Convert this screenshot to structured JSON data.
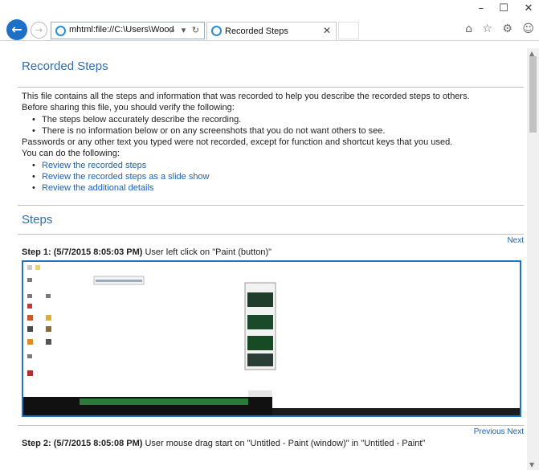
{
  "window": {
    "minimize": "–",
    "maximize": "☐",
    "close": "✕"
  },
  "browser": {
    "address": "mhtml:file://C:\\Users\\Wood",
    "address_icons": "⌕ ▾ ↻",
    "tab_title": "Recorded Steps",
    "tab_close": "✕",
    "tool_icons": "⌂ ☆ ⚙ ☺"
  },
  "page": {
    "title": "Recorded Steps",
    "intro": "This file contains all the steps and information that was recorded to help you describe the recorded steps to others.",
    "verify_intro": "Before sharing this file, you should verify the following:",
    "verify_items": [
      "The steps below accurately describe the recording.",
      "There is no information below or on any screenshots that you do not want others to see."
    ],
    "passwords_note": "Passwords or any other text you typed were not recorded, except for function and shortcut keys that you used.",
    "can_do": "You can do the following:",
    "links": [
      "Review the recorded steps",
      "Review the recorded steps as a slide show",
      "Review the additional details"
    ],
    "steps_heading": "Steps",
    "step1": {
      "nav": "Next",
      "label": "Step 1: (5/7/2015 8:05:03 PM)",
      "text": "User left click on \"Paint (button)\""
    },
    "step2": {
      "nav": "Previous Next",
      "label": "Step 2: (5/7/2015 8:05:08 PM)",
      "text": "User mouse drag start on \"Untitled - Paint (window)\" in \"Untitled - Paint\""
    }
  },
  "colors": {
    "heading": "#2e6db0",
    "link": "#1a62b5",
    "screenshot_border": "#1e73c5"
  }
}
